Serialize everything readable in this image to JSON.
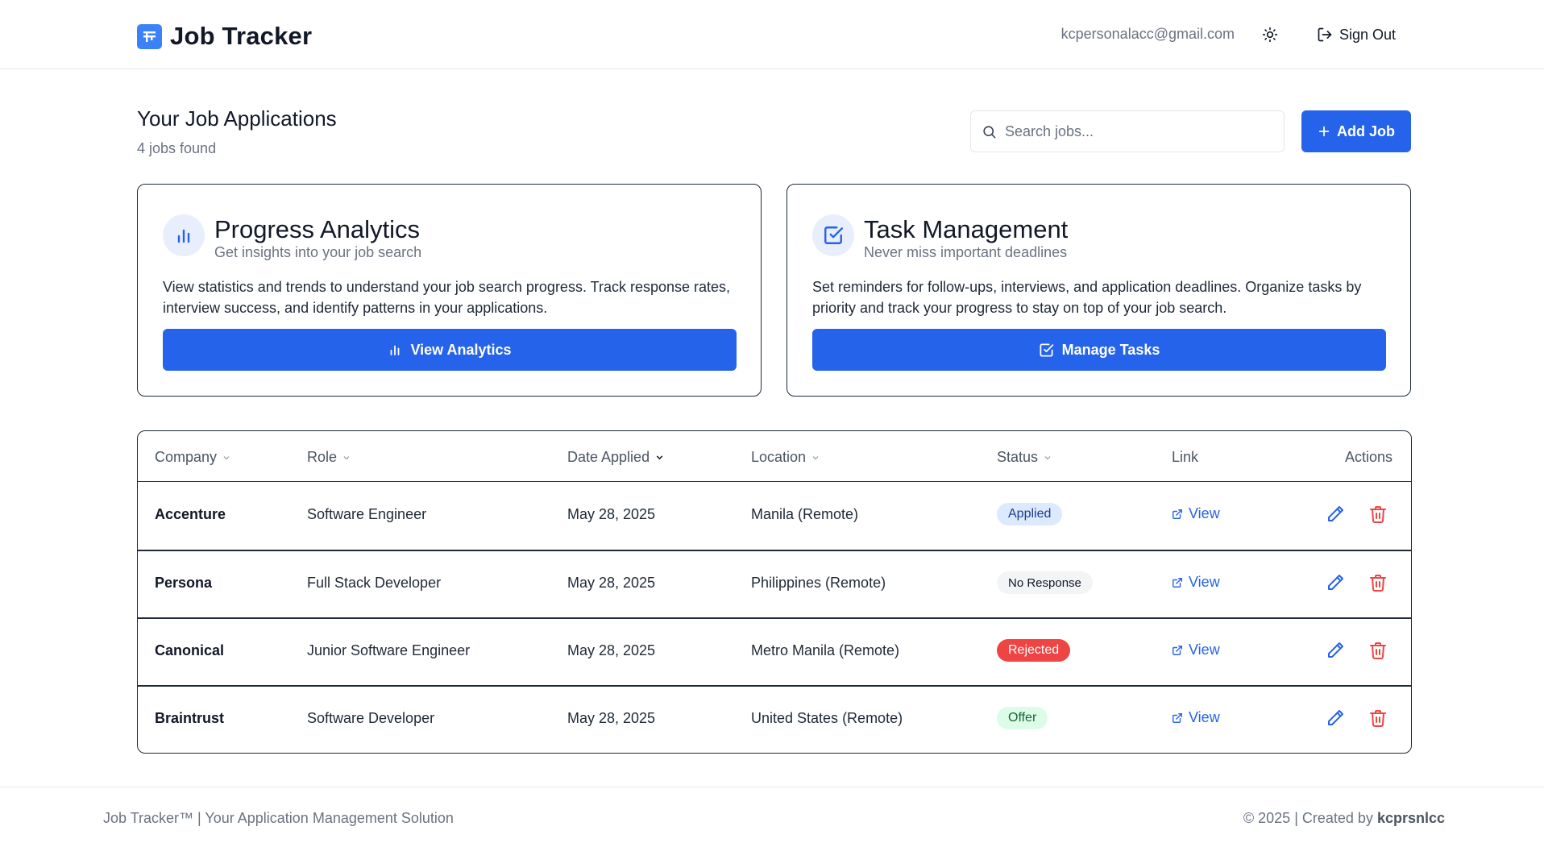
{
  "header": {
    "app_title": "Job Tracker",
    "user_email": "kcpersonalacc@gmail.com",
    "theme_icon": "sun-icon",
    "sign_out_label": "Sign Out"
  },
  "main": {
    "title": "Your Job Applications",
    "count_label": "4 jobs found",
    "search_placeholder": "Search jobs...",
    "add_job_label": "Add Job"
  },
  "cards": [
    {
      "title": "Progress Analytics",
      "subtitle": "Get insights into your job search",
      "description": "View statistics and trends to understand your job search progress. Track response rates, interview success, and identify patterns in your applications.",
      "button_label": "View Analytics",
      "icon": "bar-chart-icon"
    },
    {
      "title": "Task Management",
      "subtitle": "Never miss important deadlines",
      "description": "Set reminders for follow-ups, interviews, and application deadlines. Organize tasks by priority and track your progress to stay on top of your job search.",
      "button_label": "Manage Tasks",
      "icon": "checkbox-icon"
    }
  ],
  "table": {
    "columns": [
      "Company",
      "Role",
      "Date Applied",
      "Location",
      "Status",
      "Link",
      "Actions"
    ],
    "rows": [
      {
        "company": "Accenture",
        "role": "Software Engineer",
        "date": "May 28, 2025",
        "location": "Manila (Remote)",
        "status": "Applied",
        "link": "View"
      },
      {
        "company": "Persona",
        "role": "Full Stack Developer",
        "date": "May 28, 2025",
        "location": "Philippines (Remote)",
        "status": "No Response",
        "link": "View"
      },
      {
        "company": "Canonical",
        "role": "Junior Software Engineer",
        "date": "May 28, 2025",
        "location": "Metro Manila (Remote)",
        "status": "Rejected",
        "link": "View"
      },
      {
        "company": "Braintrust",
        "role": "Software Developer",
        "date": "May 28, 2025",
        "location": "United States (Remote)",
        "status": "Offer",
        "link": "View"
      }
    ]
  },
  "footer": {
    "left": "Job Tracker™ | Your Application Management Solution",
    "right_prefix": "© 2025 | Created by ",
    "right_author": "kcprsnlcc"
  },
  "colors": {
    "primary": "#2563eb",
    "danger": "#ef4444",
    "muted": "#6b7280"
  }
}
